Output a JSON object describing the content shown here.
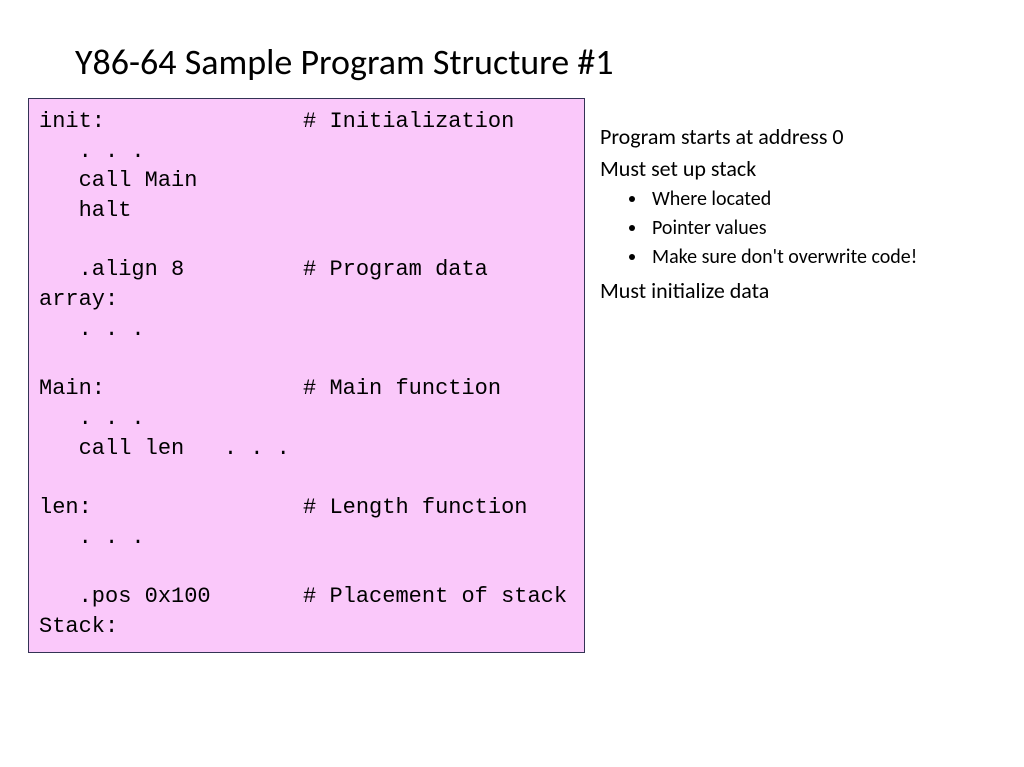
{
  "title": "Y86-64 Sample Program Structure #1",
  "code": "init:               # Initialization\n   . . .\n   call Main\n   halt\n\n   .align 8         # Program data\narray:\n   . . .\n\nMain:               # Main function\n   . . .\n   call len   . . .\n\nlen:                # Length function\n   . . .\n\n   .pos 0x100       # Placement of stack\nStack:",
  "notes": {
    "line1": "Program starts at address 0",
    "line2": "Must set up stack",
    "bullets": [
      "Where located",
      "Pointer values",
      "Make sure don't overwrite code!"
    ],
    "line3": "Must initialize data"
  }
}
